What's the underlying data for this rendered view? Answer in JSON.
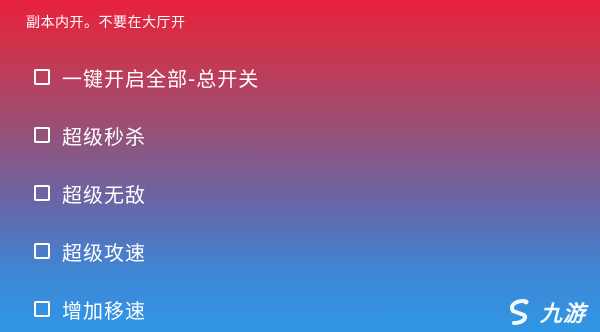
{
  "notice": "副本内开。不要在大厅开",
  "options": [
    {
      "label": "一键开启全部-总开关",
      "checked": false
    },
    {
      "label": "超级秒杀",
      "checked": false
    },
    {
      "label": "超级无敌",
      "checked": false
    },
    {
      "label": "超级攻速",
      "checked": false
    },
    {
      "label": "增加移速",
      "checked": false
    }
  ],
  "watermark": {
    "text": "九游",
    "icon": "s-logo-icon"
  },
  "colors": {
    "top": "#e8213f",
    "bottom": "#2f97e6",
    "text": "#ffffff"
  }
}
